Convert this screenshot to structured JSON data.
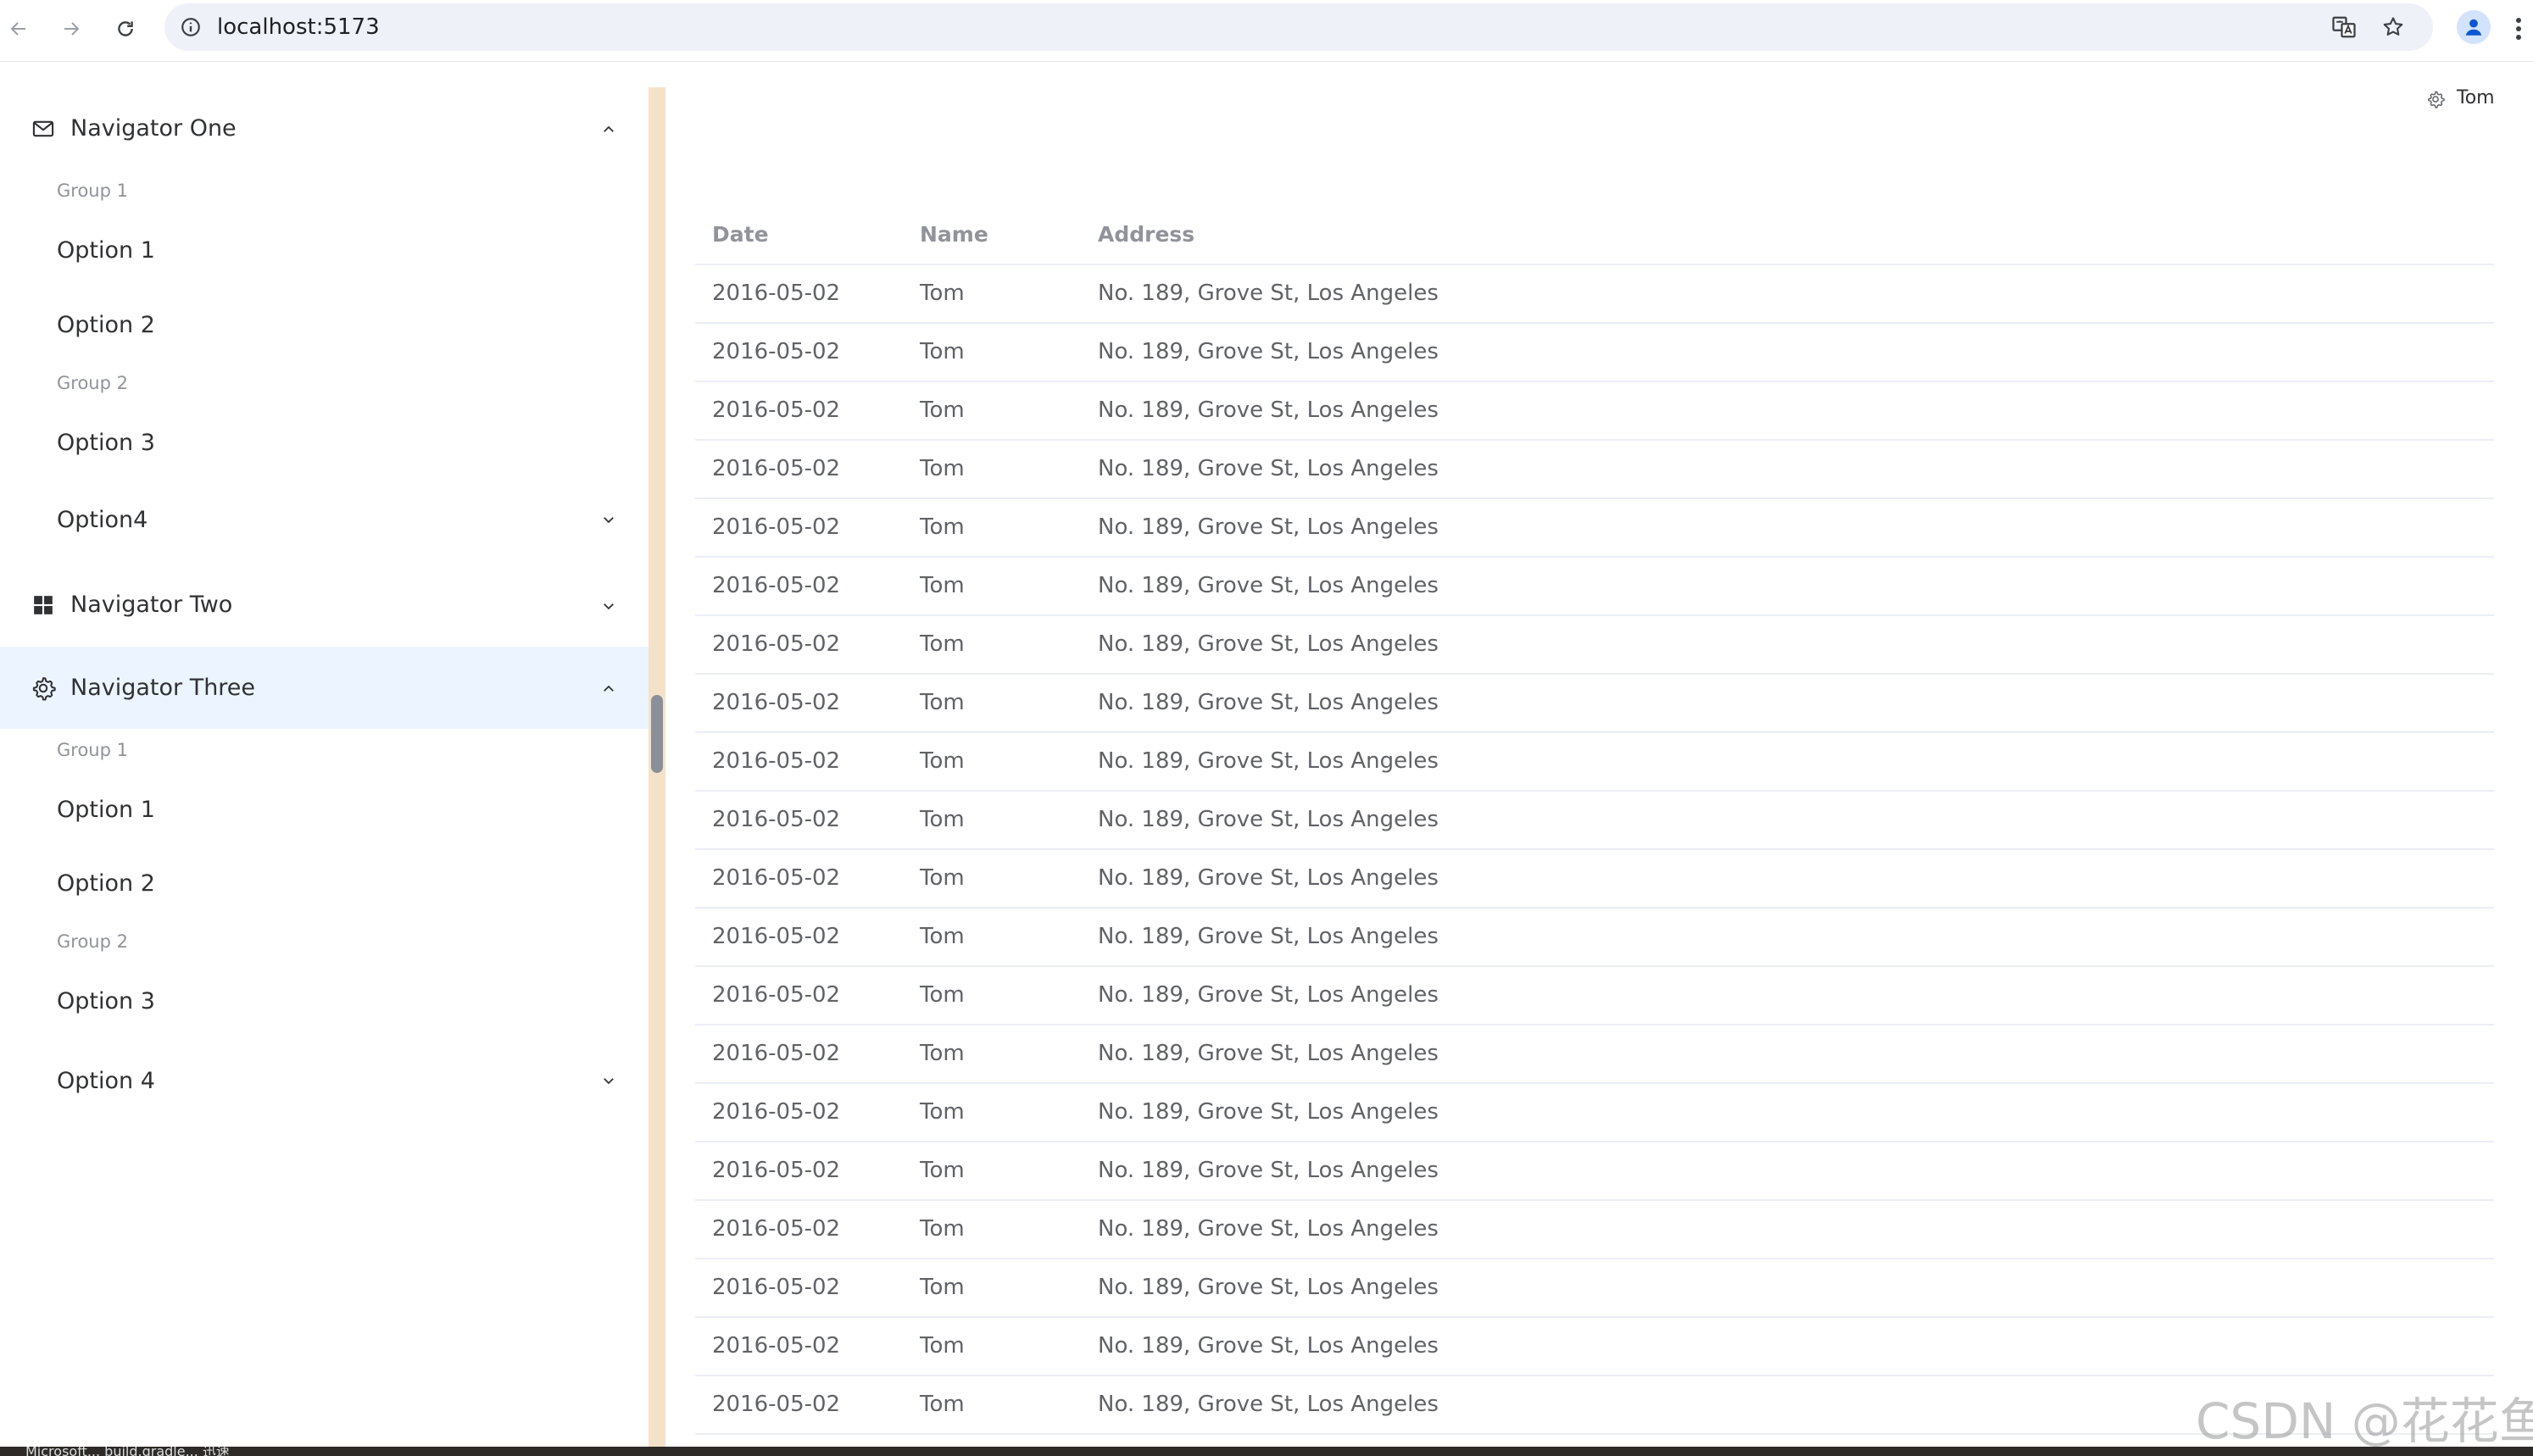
{
  "browser": {
    "url": "localhost:5173"
  },
  "sidebar": {
    "navigators": [
      {
        "label": "Navigator One",
        "icon": "mail-icon",
        "expanded": true,
        "groups": [
          {
            "label": "Group 1",
            "items": [
              "Option 1",
              "Option 2"
            ]
          },
          {
            "label": "Group 2",
            "items": [
              "Option 3"
            ]
          }
        ],
        "submenu": "Option4"
      },
      {
        "label": "Navigator Two",
        "icon": "grid-icon",
        "expanded": false
      },
      {
        "label": "Navigator Three",
        "icon": "gear-icon",
        "expanded": true,
        "active": true,
        "groups": [
          {
            "label": "Group 1",
            "items": [
              "Option 1",
              "Option 2"
            ]
          },
          {
            "label": "Group 2",
            "items": [
              "Option 3"
            ]
          }
        ],
        "submenu": "Option 4"
      }
    ]
  },
  "header": {
    "user": "Tom",
    "icon": "gear-icon"
  },
  "table": {
    "columns": [
      "Date",
      "Name",
      "Address"
    ],
    "rows": [
      [
        "2016-05-02",
        "Tom",
        "No. 189, Grove St, Los Angeles"
      ],
      [
        "2016-05-02",
        "Tom",
        "No. 189, Grove St, Los Angeles"
      ],
      [
        "2016-05-02",
        "Tom",
        "No. 189, Grove St, Los Angeles"
      ],
      [
        "2016-05-02",
        "Tom",
        "No. 189, Grove St, Los Angeles"
      ],
      [
        "2016-05-02",
        "Tom",
        "No. 189, Grove St, Los Angeles"
      ],
      [
        "2016-05-02",
        "Tom",
        "No. 189, Grove St, Los Angeles"
      ],
      [
        "2016-05-02",
        "Tom",
        "No. 189, Grove St, Los Angeles"
      ],
      [
        "2016-05-02",
        "Tom",
        "No. 189, Grove St, Los Angeles"
      ],
      [
        "2016-05-02",
        "Tom",
        "No. 189, Grove St, Los Angeles"
      ],
      [
        "2016-05-02",
        "Tom",
        "No. 189, Grove St, Los Angeles"
      ],
      [
        "2016-05-02",
        "Tom",
        "No. 189, Grove St, Los Angeles"
      ],
      [
        "2016-05-02",
        "Tom",
        "No. 189, Grove St, Los Angeles"
      ],
      [
        "2016-05-02",
        "Tom",
        "No. 189, Grove St, Los Angeles"
      ],
      [
        "2016-05-02",
        "Tom",
        "No. 189, Grove St, Los Angeles"
      ],
      [
        "2016-05-02",
        "Tom",
        "No. 189, Grove St, Los Angeles"
      ],
      [
        "2016-05-02",
        "Tom",
        "No. 189, Grove St, Los Angeles"
      ],
      [
        "2016-05-02",
        "Tom",
        "No. 189, Grove St, Los Angeles"
      ],
      [
        "2016-05-02",
        "Tom",
        "No. 189, Grove St, Los Angeles"
      ],
      [
        "2016-05-02",
        "Tom",
        "No. 189, Grove St, Los Angeles"
      ],
      [
        "2016-05-02",
        "Tom",
        "No. 189, Grove St, Los Angeles"
      ]
    ]
  },
  "taskbar": {
    "text": "Microsoft... build.gradle... 迅速"
  },
  "watermark": "CSDN @花花鱼",
  "colors": {
    "active_menu_bg": "#ecf5ff",
    "header_text": "#909399",
    "cell_text": "#606266",
    "border": "#ebeef5",
    "scroll_track": "#f4e2c8"
  }
}
